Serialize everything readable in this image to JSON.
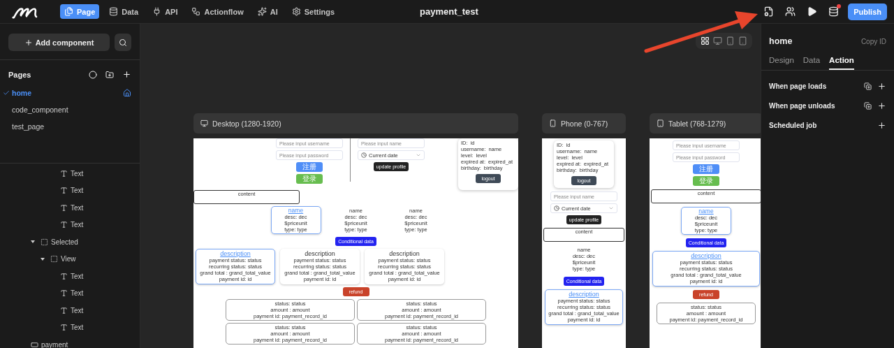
{
  "topbar": {
    "tabs": [
      {
        "kind": "page",
        "label": "Page",
        "selected": true
      },
      {
        "kind": "data",
        "label": "Data",
        "selected": false
      },
      {
        "kind": "api",
        "label": "API",
        "selected": false
      },
      {
        "kind": "flow",
        "label": "Actionflow",
        "selected": false
      },
      {
        "kind": "ai",
        "label": "AI",
        "selected": false
      },
      {
        "kind": "settings",
        "label": "Settings",
        "selected": false
      }
    ],
    "title": "payment_test",
    "sync_alert": true,
    "publish": "Publish"
  },
  "sidebar": {
    "add_component": "Add component",
    "pages_title": "Pages",
    "pages": [
      {
        "name": "home",
        "selected": true,
        "home": true
      },
      {
        "name": "code_component",
        "selected": false,
        "home": false
      },
      {
        "name": "test_page",
        "selected": false,
        "home": false
      }
    ],
    "tree": [
      {
        "kind": "text",
        "label": "Text"
      },
      {
        "kind": "text",
        "label": "Text"
      },
      {
        "kind": "text",
        "label": "Text"
      },
      {
        "kind": "text",
        "label": "Text"
      },
      {
        "kind": "view",
        "label": "Selected",
        "expanded": true,
        "children": [
          {
            "kind": "view",
            "label": "View",
            "expanded": true,
            "children": [
              {
                "kind": "text",
                "label": "Text"
              },
              {
                "kind": "text",
                "label": "Text"
              },
              {
                "kind": "text",
                "label": "Text"
              },
              {
                "kind": "text",
                "label": "Text"
              }
            ]
          }
        ]
      },
      {
        "kind": "button",
        "label": "payment"
      }
    ]
  },
  "canvas": {
    "devices": [
      {
        "kind": "all",
        "selected": true
      },
      {
        "kind": "desktop",
        "selected": false
      },
      {
        "kind": "phone",
        "selected": false
      },
      {
        "kind": "tablet",
        "selected": false
      }
    ],
    "frames": [
      {
        "kind": "desktop",
        "title": "Desktop (1280-1920)",
        "login": {
          "username_placeholder": "Please input username",
          "password_placeholder": "Please input password",
          "register": "注册",
          "signin": "登录"
        },
        "profile_form": {
          "name_placeholder": "Please input name",
          "date": "Current date",
          "button": "update profile"
        },
        "profile_card": {
          "fields": [
            {
              "label": "ID:",
              "value": "id"
            },
            {
              "label": "username:",
              "value": "name"
            },
            {
              "label": "level:",
              "value": "level"
            },
            {
              "label": "expired at:",
              "value": "expired_at"
            },
            {
              "label": "birthday:",
              "value": "birthday"
            }
          ],
          "button": "logout"
        },
        "content": "content",
        "products": [
          {
            "name": "name",
            "desc": "desc: dec",
            "price": "$priceunit",
            "type": "type: type",
            "selected": true
          },
          {
            "name": "name",
            "desc": "desc: dec",
            "price": "$priceunit",
            "type": "type: type",
            "selected": false
          },
          {
            "name": "name",
            "desc": "desc: dec",
            "price": "$priceunit",
            "type": "type: type",
            "selected": false
          }
        ],
        "conditional": "Conditional data",
        "payments": [
          {
            "title": "description",
            "lines": [
              "payment status: status",
              "recurring status: status",
              "grand total : grand_total_value",
              "payment id: id"
            ],
            "selected": true
          },
          {
            "title": "description",
            "lines": [
              "payment status: status",
              "recurring status: status",
              "grand total : grand_total_value",
              "payment id: id"
            ],
            "selected": false
          },
          {
            "title": "description",
            "lines": [
              "payment status: status",
              "recurring status: status",
              "grand total : grand_total_value",
              "payment id: id"
            ],
            "selected": false
          }
        ],
        "refund": "refund",
        "records": [
          {
            "lines": [
              "status: status",
              "amount : amount",
              "payment id: payment_record_id"
            ]
          },
          {
            "lines": [
              "status: status",
              "amount : amount",
              "payment id: payment_record_id"
            ]
          },
          {
            "lines": [
              "status: status",
              "amount : amount",
              "payment id: payment_record_id"
            ]
          },
          {
            "lines": [
              "status: status",
              "amount : amount",
              "payment id: payment_record_id"
            ]
          }
        ]
      },
      {
        "kind": "phone",
        "title": "Phone (0-767)",
        "blocks": [
          {
            "kind": "profile_card",
            "fields": [
              {
                "label": "ID:",
                "value": "id"
              },
              {
                "label": "username:",
                "value": "name"
              },
              {
                "label": "level:",
                "value": "level"
              },
              {
                "label": "expired at:",
                "value": "expired_at"
              },
              {
                "label": "birthday:",
                "value": "birthday"
              }
            ],
            "button": "logout"
          },
          {
            "kind": "profile_form",
            "name_placeholder": "Please input name",
            "date": "Current date",
            "button": "update profile"
          },
          {
            "kind": "content",
            "text": "content"
          },
          {
            "kind": "product",
            "name": "name",
            "desc": "desc: dec",
            "price": "$priceunit",
            "type": "type: type",
            "selected": false
          },
          {
            "kind": "conditional",
            "text": "Conditional data"
          },
          {
            "kind": "payment",
            "title": "description",
            "lines": [
              "payment status: status",
              "recurring status: status",
              "grand total : grand_total_value",
              "payment id: id"
            ],
            "selected": true
          }
        ]
      },
      {
        "kind": "tablet",
        "title": "Tablet (768-1279)",
        "blocks": [
          {
            "kind": "login",
            "username_placeholder": "Please input username",
            "password_placeholder": "Please input password",
            "register": "注册",
            "signin": "登录"
          },
          {
            "kind": "content",
            "text": "content"
          },
          {
            "kind": "product",
            "name": "name",
            "desc": "desc: dec",
            "price": "$priceunit",
            "type": "type: type",
            "selected": true
          },
          {
            "kind": "conditional",
            "text": "Conditional data"
          },
          {
            "kind": "payment",
            "title": "description",
            "lines": [
              "payment status: status",
              "recurring status: status",
              "grand total : grand_total_value",
              "payment id: id"
            ],
            "selected": true
          },
          {
            "kind": "refund",
            "text": "refund"
          },
          {
            "kind": "record",
            "lines": [
              "status: status",
              "amount : amount",
              "payment id: payment_record_id"
            ]
          }
        ]
      }
    ]
  },
  "panel": {
    "title": "home",
    "copy_id": "Copy ID",
    "tabs": [
      {
        "label": "Design",
        "selected": false
      },
      {
        "label": "Data",
        "selected": false
      },
      {
        "label": "Action",
        "selected": true
      }
    ],
    "events": [
      {
        "label": "When page loads",
        "has_copy": true
      },
      {
        "label": "When page unloads",
        "has_copy": true
      },
      {
        "label": "Scheduled job",
        "has_copy": false
      }
    ]
  }
}
